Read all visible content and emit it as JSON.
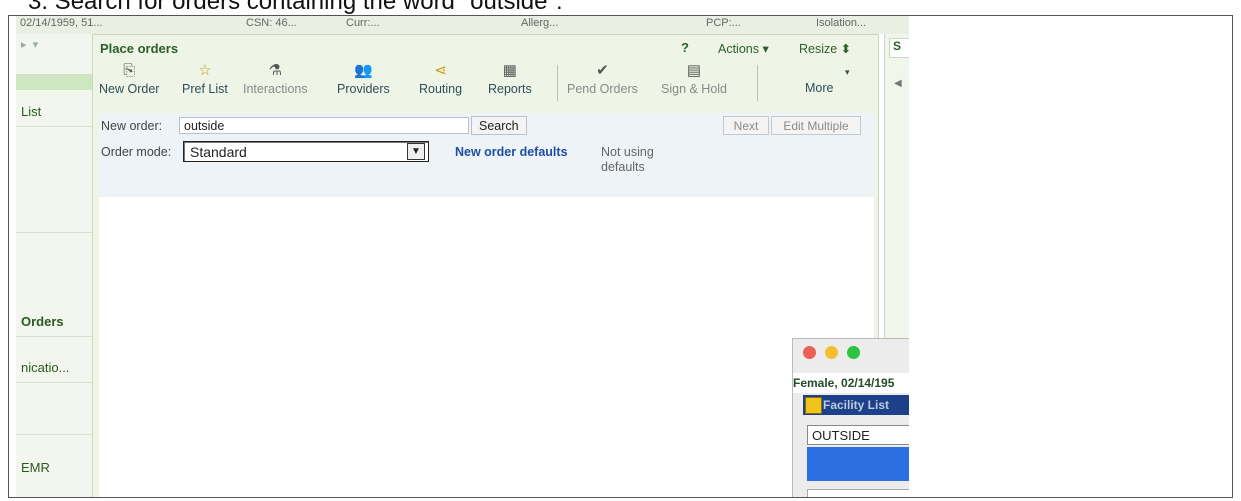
{
  "caption": "3. Search for orders containing the word \"outside\":",
  "patient_bar": {
    "dob": "02/14/1959, 51...",
    "csn": "CSN: 46...",
    "curr": "Curr:...",
    "allergies": "Allerg...",
    "pcp": "PCP:...",
    "isolation": "Isolation..."
  },
  "left_nav": {
    "items": [
      "List",
      "Orders",
      "nicatio...",
      "EMR"
    ]
  },
  "panel": {
    "title": "Place orders",
    "help": "?",
    "actions": "Actions ▾",
    "resize": "Resize ⬍"
  },
  "toolbar": {
    "buttons": [
      {
        "label": "New Order",
        "icon": "new-order-icon"
      },
      {
        "label": "Pref List",
        "icon": "pref-list-icon"
      },
      {
        "label": "Interactions",
        "icon": "interactions-icon"
      },
      {
        "label": "Providers",
        "icon": "providers-icon"
      },
      {
        "label": "Routing",
        "icon": "routing-icon"
      },
      {
        "label": "Reports",
        "icon": "reports-icon"
      },
      {
        "label": "Pend Orders",
        "icon": "pend-orders-icon"
      },
      {
        "label": "Sign & Hold",
        "icon": "sign-hold-icon"
      },
      {
        "label": "More",
        "icon": "more-chevron-icon"
      }
    ]
  },
  "order_entry": {
    "new_order_label": "New order:",
    "new_order_value": "outside",
    "search_label": "Search",
    "next_label": "Next",
    "edit_multiple_label": "Edit Multiple",
    "order_mode_label": "Order mode:",
    "order_mode_value": "Standard",
    "new_order_defaults": "New order defaults",
    "not_using_defaults": "Not using defaults"
  },
  "right_panel": {
    "tab": "S"
  },
  "popup": {
    "patient_info": "Female, 02/14/195",
    "window_title": "Facility List",
    "search_value": "OUTSIDE"
  }
}
